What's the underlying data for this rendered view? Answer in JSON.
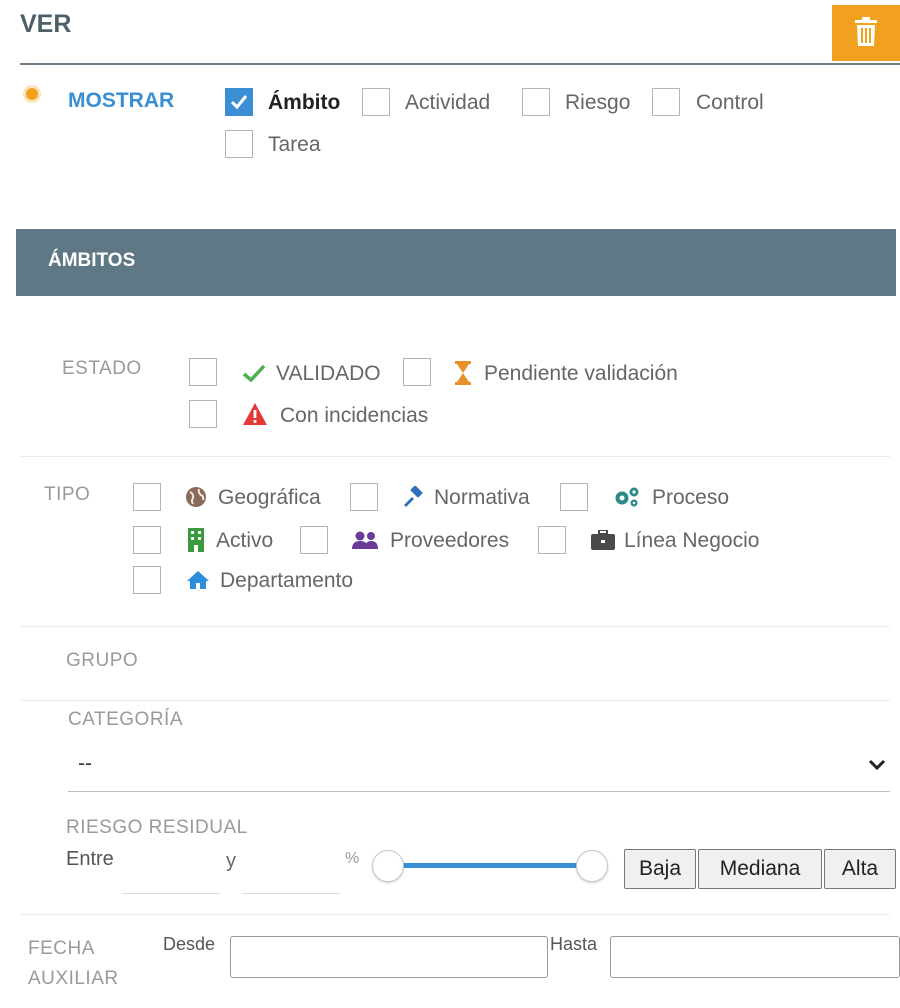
{
  "header": {
    "title": "VER"
  },
  "mostrar": {
    "label": "MOSTRAR",
    "options": [
      {
        "label": "Ámbito",
        "checked": true
      },
      {
        "label": "Actividad",
        "checked": false
      },
      {
        "label": "Riesgo",
        "checked": false
      },
      {
        "label": "Control",
        "checked": false
      },
      {
        "label": "Tarea",
        "checked": false
      }
    ]
  },
  "section": {
    "title": "ÁMBITOS"
  },
  "estado": {
    "label": "ESTADO",
    "options": [
      {
        "label": "VALIDADO",
        "icon": "check-icon"
      },
      {
        "label": "Pendiente validación",
        "icon": "hourglass-icon"
      },
      {
        "label": "Con incidencias",
        "icon": "warning-icon"
      }
    ]
  },
  "tipo": {
    "label": "TIPO",
    "options": [
      {
        "label": "Geográfica",
        "icon": "globe-icon"
      },
      {
        "label": "Normativa",
        "icon": "gavel-icon"
      },
      {
        "label": "Proceso",
        "icon": "gears-icon"
      },
      {
        "label": "Activo",
        "icon": "building-icon"
      },
      {
        "label": "Proveedores",
        "icon": "users-icon"
      },
      {
        "label": "Línea Negocio",
        "icon": "briefcase-icon"
      },
      {
        "label": "Departamento",
        "icon": "home-icon"
      }
    ]
  },
  "grupo": {
    "label": "GRUPO"
  },
  "categoria": {
    "label": "CATEGORÍA",
    "selected": "--"
  },
  "riesgo_residual": {
    "label": "RIESGO RESIDUAL",
    "entre": "Entre",
    "y": "y",
    "percent": "%",
    "buttons": [
      "Baja",
      "Mediana",
      "Alta"
    ]
  },
  "fecha_auxiliar": {
    "label_line1": "FECHA",
    "label_line2": "AUXILIAR",
    "desde": "Desde",
    "hasta": "Hasta"
  },
  "colors": {
    "accent": "#3a8ed4",
    "header_bar": "#5f7885",
    "trash_button": "#f2a11f",
    "bullet": "#f2a11f",
    "valid_green": "#4caf50",
    "pending_orange": "#e8902a",
    "warning_red": "#e53935"
  }
}
